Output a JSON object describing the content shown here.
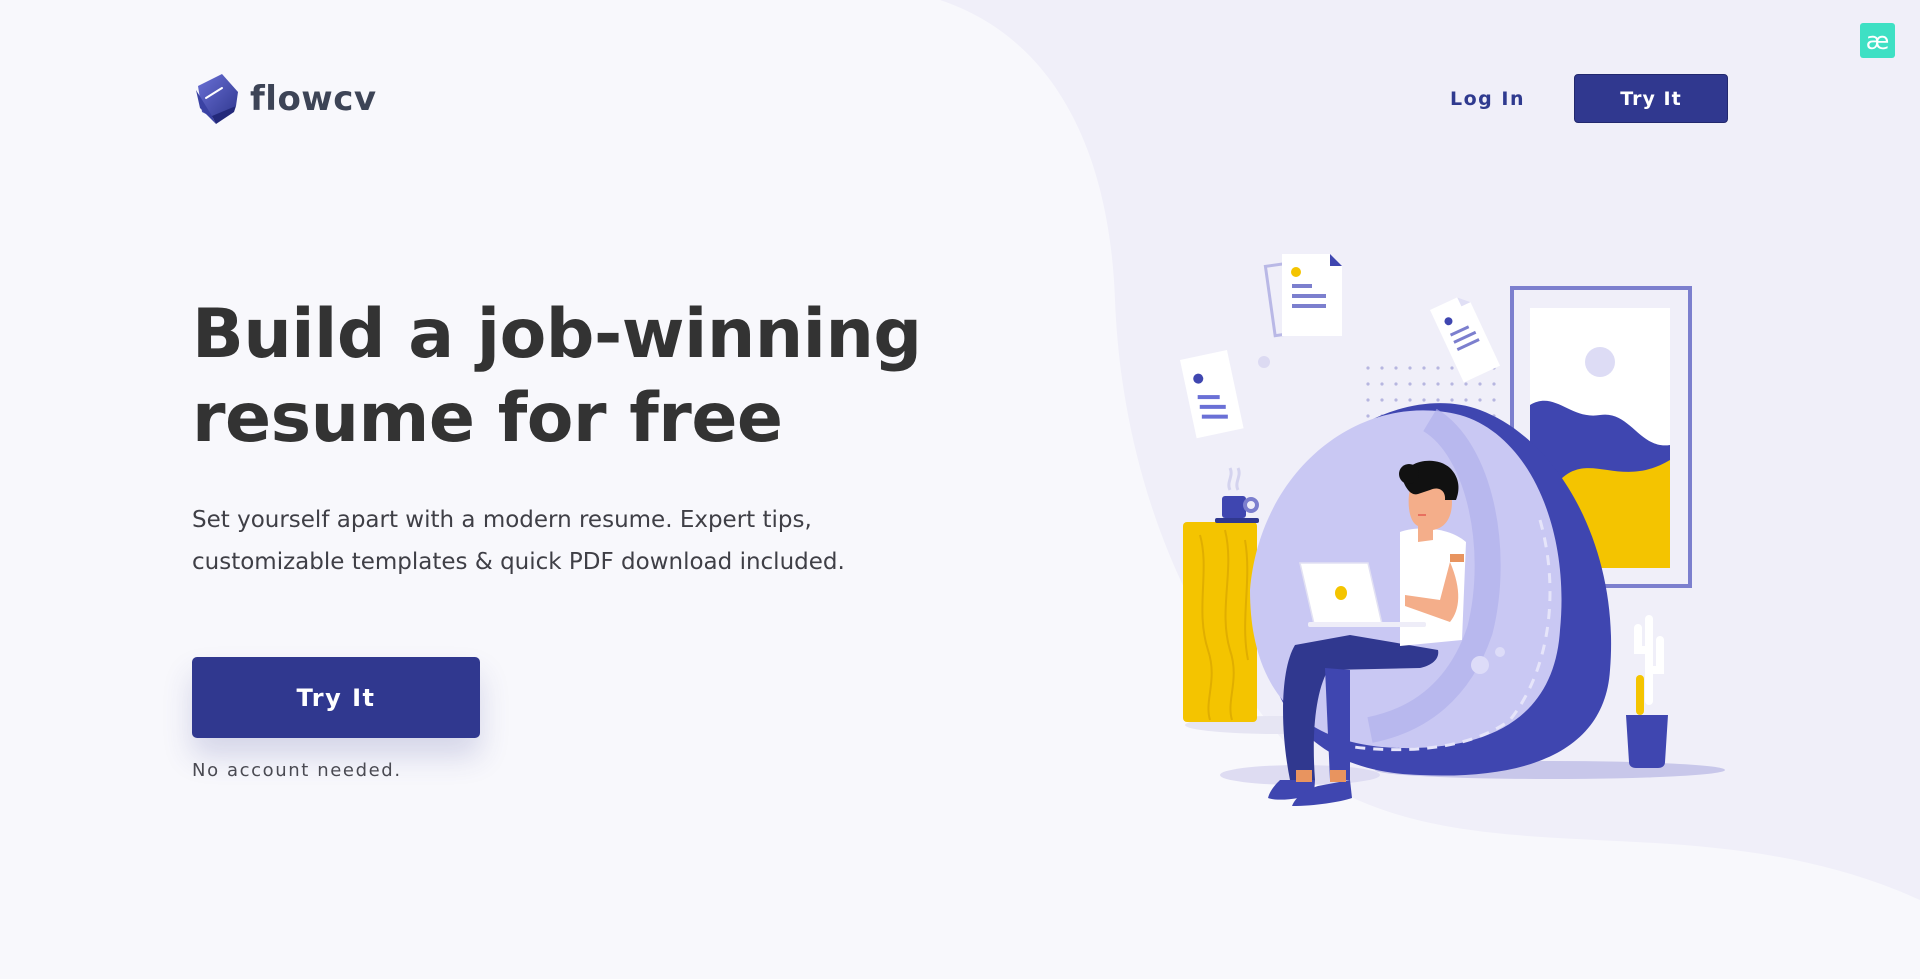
{
  "header": {
    "logo_text": "flowcv",
    "login_label": "Log In",
    "try_label": "Try It"
  },
  "extension_badge": {
    "glyph": "æ",
    "color": "#3ee0c4"
  },
  "hero": {
    "title_line1": "Build a job-winning",
    "title_line2": "resume for free",
    "subtitle_line1": "Set yourself apart with a modern resume. Expert tips,",
    "subtitle_line2": "customizable templates & quick PDF download included.",
    "cta_label": "Try It",
    "cta_note": "No account needed."
  },
  "colors": {
    "brand": "#30388f",
    "accent_yellow": "#f4c400",
    "lavender": "#c9c8f3",
    "background": "#f8f8fc"
  },
  "illustration": {
    "icons": [
      "document-icon",
      "coffee-cup-icon",
      "laptop-icon",
      "picture-frame-icon",
      "plant-icon",
      "bean-bag-icon",
      "person-icon"
    ]
  }
}
